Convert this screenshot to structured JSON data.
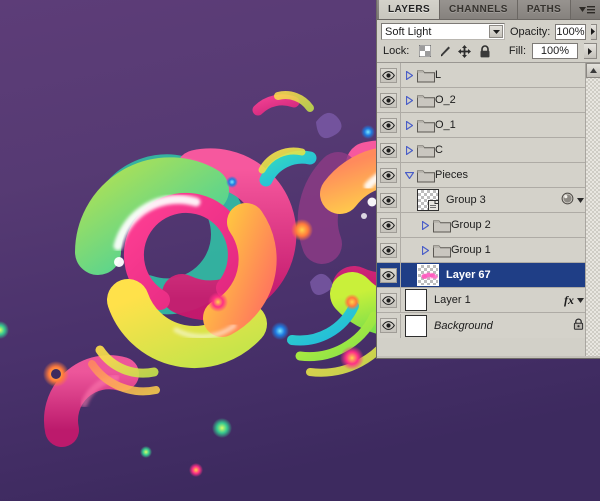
{
  "canvas": {
    "name": "artwork-canvas",
    "background_top": "#5b3b76",
    "background_bottom": "#3e2b60",
    "description": "Abstract glossy colorful ring shapes on purple gradient"
  },
  "panel": {
    "tabs": [
      {
        "label": "LAYERS",
        "active": true
      },
      {
        "label": "CHANNELS",
        "active": false
      },
      {
        "label": "PATHS",
        "active": false
      }
    ],
    "menu_icon": "panel-menu-icon",
    "blend_mode": {
      "value": "Soft Light",
      "arrow_icon": "chevron-down-icon"
    },
    "opacity": {
      "label": "Opacity:",
      "value": "100%",
      "arrow_icon": "chevron-right-icon"
    },
    "fill": {
      "label": "Fill:",
      "value": "100%",
      "arrow_icon": "chevron-right-icon"
    },
    "lock": {
      "label": "Lock:",
      "icons": [
        "lock-transparency-icon",
        "lock-pixels-icon",
        "lock-position-icon",
        "lock-all-icon"
      ]
    },
    "scrollbar": {
      "up_arrow_icon": "scroll-up-icon"
    },
    "layers": [
      {
        "name": "L",
        "type": "group",
        "indent": 0,
        "visible": true,
        "expanded": false,
        "selected": false,
        "thumb": "folder",
        "badges": []
      },
      {
        "name": "O_2",
        "type": "group",
        "indent": 0,
        "visible": true,
        "expanded": false,
        "selected": false,
        "thumb": "folder",
        "badges": []
      },
      {
        "name": "O_1",
        "type": "group",
        "indent": 0,
        "visible": true,
        "expanded": false,
        "selected": false,
        "thumb": "folder",
        "badges": []
      },
      {
        "name": "C",
        "type": "group",
        "indent": 0,
        "visible": true,
        "expanded": false,
        "selected": false,
        "thumb": "folder",
        "badges": []
      },
      {
        "name": "Pieces",
        "type": "group",
        "indent": 0,
        "visible": true,
        "expanded": true,
        "selected": false,
        "thumb": "folder",
        "badges": []
      },
      {
        "name": "Group 3",
        "type": "smart-object",
        "indent": 1,
        "visible": true,
        "expanded": false,
        "selected": false,
        "thumb": "smart",
        "badges": [
          "style",
          "expand"
        ]
      },
      {
        "name": "Group 2",
        "type": "group",
        "indent": 1,
        "visible": true,
        "expanded": false,
        "selected": false,
        "thumb": "folder",
        "badges": []
      },
      {
        "name": "Group 1",
        "type": "group",
        "indent": 1,
        "visible": true,
        "expanded": false,
        "selected": false,
        "thumb": "folder",
        "badges": []
      },
      {
        "name": "Layer 67",
        "type": "pixel",
        "indent": 1,
        "visible": true,
        "expanded": false,
        "selected": true,
        "thumb": "pink",
        "badges": []
      },
      {
        "name": "Layer 1",
        "type": "pixel",
        "indent": 0,
        "visible": true,
        "expanded": false,
        "selected": false,
        "thumb": "white",
        "badges": [
          "fx",
          "expand"
        ]
      },
      {
        "name": "Background",
        "type": "background",
        "indent": 0,
        "visible": true,
        "expanded": false,
        "selected": false,
        "thumb": "white",
        "badges": [
          "locked"
        ],
        "italic": true
      }
    ]
  }
}
